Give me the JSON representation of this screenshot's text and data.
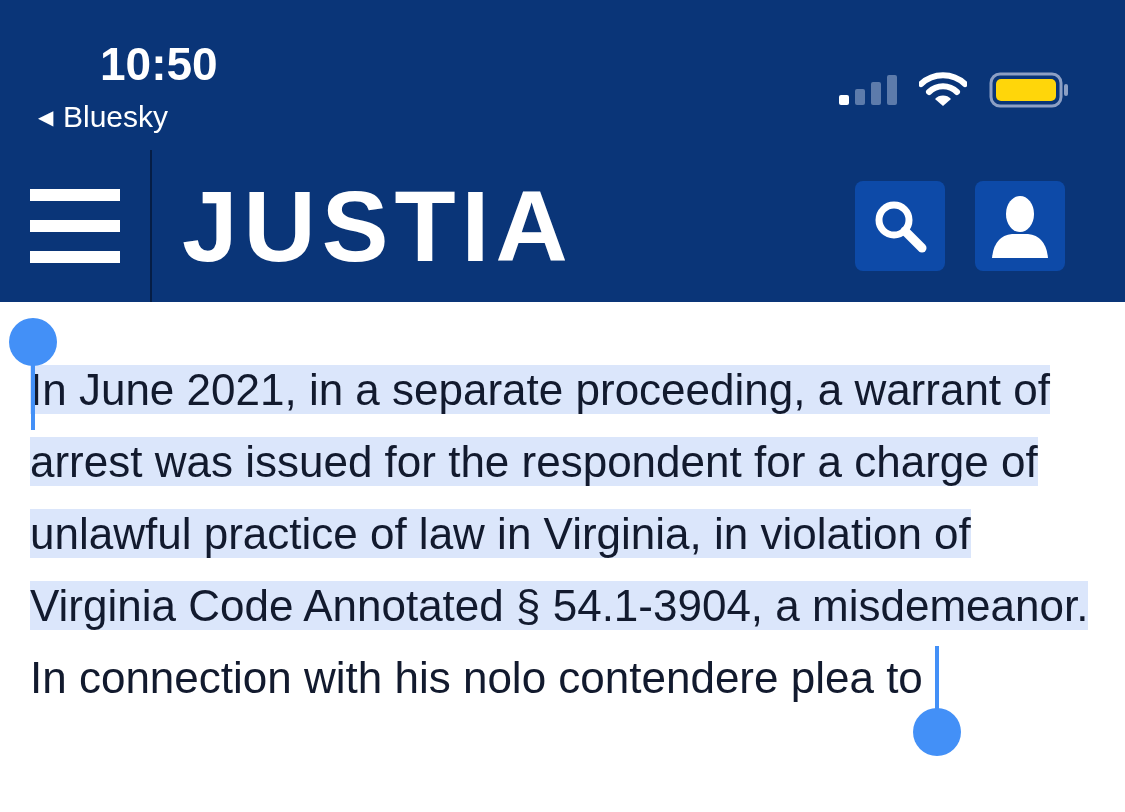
{
  "status_bar": {
    "time": "10:50",
    "back_arrow": "◀",
    "back_label": "Bluesky"
  },
  "header": {
    "logo": "JUSTIA"
  },
  "paragraph": {
    "selected_text": "In June 2021, in a separate proceeding, a warrant of arrest was issued for the respondent for a charge of unlawful practice of law in Virginia, in violation of Virginia Code Annotated § 54.1-3904, a misdemeanor.",
    "rest": "In connection with his nolo contendere plea to"
  }
}
